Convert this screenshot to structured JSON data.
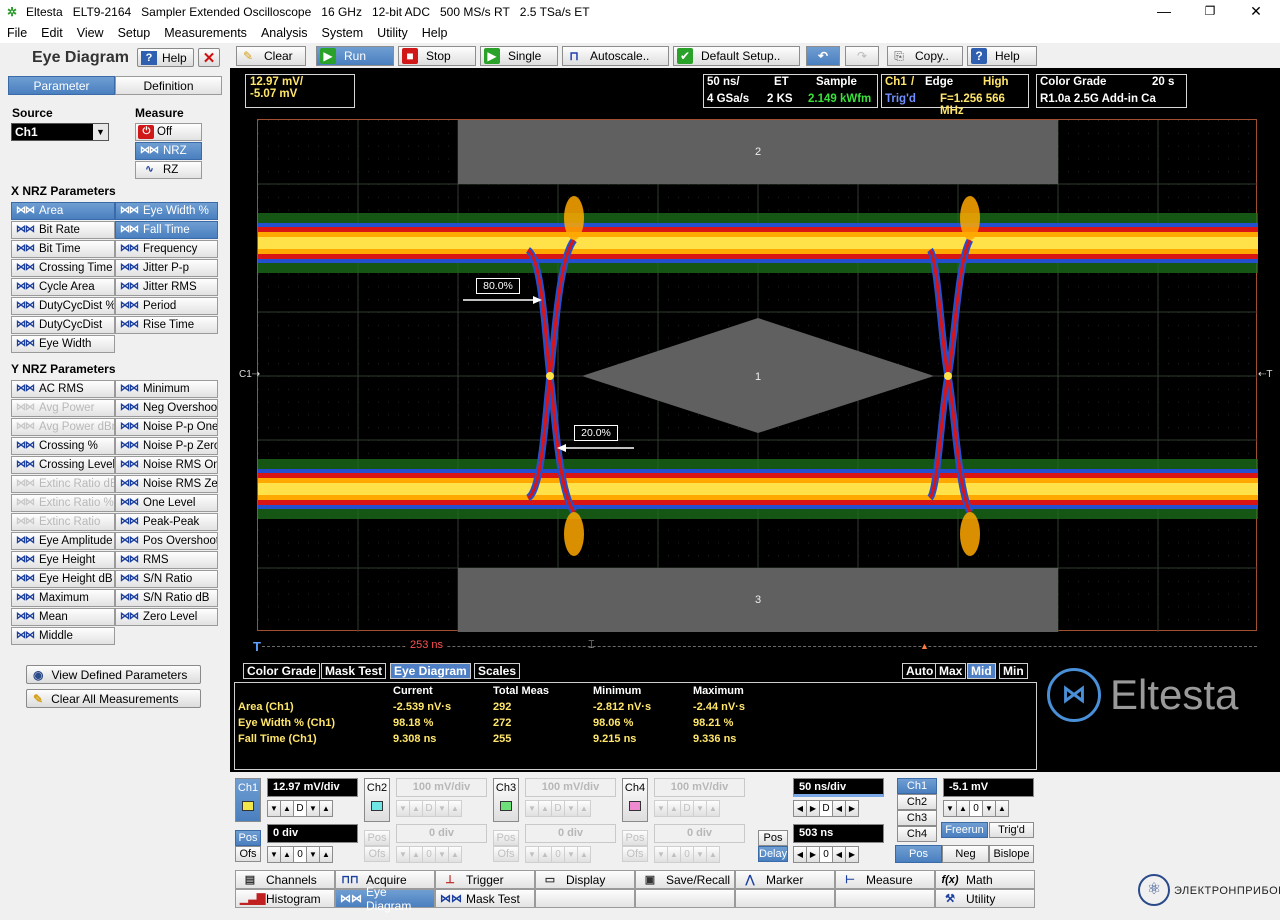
{
  "titlebar": {
    "app": "Eltesta",
    "model": "ELT9-2164",
    "desc": "Sampler Extended Oscilloscope",
    "bw": "16 GHz",
    "adc": "12-bit ADC",
    "rt": "500 MS/s RT",
    "et": "2.5 TSa/s ET"
  },
  "menu": [
    "File",
    "Edit",
    "View",
    "Setup",
    "Measurements",
    "Analysis",
    "System",
    "Utility",
    "Help"
  ],
  "left": {
    "title": "Eye Diagram",
    "help": "Help",
    "tab_parameter": "Parameter",
    "tab_definition": "Definition",
    "source_label": "Source",
    "source_value": "Ch1",
    "measure_label": "Measure",
    "measure_off": "Off",
    "measure_nrz": "NRZ",
    "measure_rz": "RZ",
    "x_title": "X NRZ Parameters",
    "x_left": [
      "Area",
      "Bit Rate",
      "Bit Time",
      "Crossing Time",
      "Cycle Area",
      "DutyCycDist %",
      "DutyCycDist",
      "Eye Width"
    ],
    "x_right": [
      "Eye Width %",
      "Fall Time",
      "Frequency",
      "Jitter P-p",
      "Jitter RMS",
      "Period",
      "Rise Time"
    ],
    "y_title": "Y NRZ Parameters",
    "y_left": [
      "AC RMS",
      "Avg Power",
      "Avg Power dBm",
      "Crossing %",
      "Crossing Level",
      "Extinc Ratio dB",
      "Extinc Ratio %",
      "Extinc Ratio",
      "Eye Amplitude",
      "Eye Height",
      "Eye Height dB",
      "Maximum",
      "Mean",
      "Middle"
    ],
    "y_right": [
      "Minimum",
      "Neg Overshoot",
      "Noise P-p One",
      "Noise P-p Zero",
      "Noise RMS One",
      "Noise RMS Zero",
      "One Level",
      "Peak-Peak",
      "Pos Overshoot",
      "RMS",
      "S/N Ratio",
      "S/N Ratio dB",
      "Zero Level"
    ],
    "view_defined": "View Defined Parameters",
    "clear_all": "Clear All Measurements"
  },
  "toolbar": [
    "Clear",
    "Run",
    "Stop",
    "Single",
    "Autoscale..",
    "Default Setup..",
    "Copy..",
    "Help"
  ],
  "screen": {
    "scale_line1": "12.97 mV/",
    "scale_line2": "-5.07 mV",
    "time_div": "50 ns/",
    "mode": "ET",
    "acq": "Sample",
    "rate": "4 GSa/s",
    "points": "2 KS",
    "wfm_rate": "2.149 kWfm",
    "trig_ch": "Ch1",
    "trig_slash": "/",
    "trig_type": "Edge",
    "trig_level": "High",
    "trig_state": "Trig'd",
    "trig_freq": "F=1.256 566 MHz",
    "cg_label": "Color Grade",
    "cg_time": "20 s",
    "cg_info": "R1.0a 2.5G Add-in Ca",
    "level80": "80.0%",
    "level20": "20.0%",
    "mask1": "1",
    "mask2": "2",
    "mask3": "3",
    "ch_marker": "C1",
    "t_marker": "T",
    "t_left": "T",
    "delay_readout": "253 ns"
  },
  "tabs": [
    "Color Grade",
    "Mask Test",
    "Eye Diagram",
    "Scales"
  ],
  "stat_btns": [
    "Auto",
    "Max",
    "Mid",
    "Min"
  ],
  "meas": {
    "headers": [
      "Current",
      "Total Meas",
      "Minimum",
      "Maximum"
    ],
    "rows": [
      {
        "name": "Area (Ch1)",
        "cur": "-2.539 nV·s",
        "total": "292",
        "min": "-2.812 nV·s",
        "max": "-2.44 nV·s"
      },
      {
        "name": "Eye Width % (Ch1)",
        "cur": "98.18 %",
        "total": "272",
        "min": "98.06 %",
        "max": "98.21 %"
      },
      {
        "name": "Fall Time (Ch1)",
        "cur": "9.308 ns",
        "total": "255",
        "min": "9.215 ns",
        "max": "9.336 ns"
      }
    ]
  },
  "logo": "Eltesta",
  "channels": [
    {
      "name": "Ch1",
      "scale": "12.97 mV/div",
      "offset": "0 div",
      "color": "#f3e64a"
    },
    {
      "name": "Ch2",
      "scale": "100 mV/div",
      "offset": "0 div",
      "color": "#6ee6e6"
    },
    {
      "name": "Ch3",
      "scale": "100 mV/div",
      "offset": "0 div",
      "color": "#6ee07a"
    },
    {
      "name": "Ch4",
      "scale": "100 mV/div",
      "offset": "0 div",
      "color": "#f08ad0"
    }
  ],
  "pos": "Pos",
  "ofs": "Ofs",
  "delay": "Delay",
  "spin_mid": "D",
  "spin_zero": "0",
  "timebase": {
    "scale": "50 ns/div",
    "delay": "503 ns"
  },
  "trigger": {
    "channels": [
      "Ch1",
      "Ch2",
      "Ch3",
      "Ch4"
    ],
    "level": "-5.1 mV",
    "freerun": "Freerun",
    "trigd": "Trig'd",
    "slopes": [
      "Pos",
      "Neg",
      "Bislope"
    ]
  },
  "nav": [
    [
      "Channels",
      "Acquire",
      "Trigger",
      "Display",
      "Save/Recall",
      "Marker",
      "Measure",
      "Math"
    ],
    [
      "Histogram",
      "Eye Diagram",
      "Mask Test",
      "",
      "",
      "",
      "",
      "Utility"
    ]
  ],
  "brand": "ЭЛЕКТРОНПРИБОР",
  "colors": {
    "accent": "#4a7fbf",
    "grid_border": "#a05030",
    "mask": "#606060"
  }
}
